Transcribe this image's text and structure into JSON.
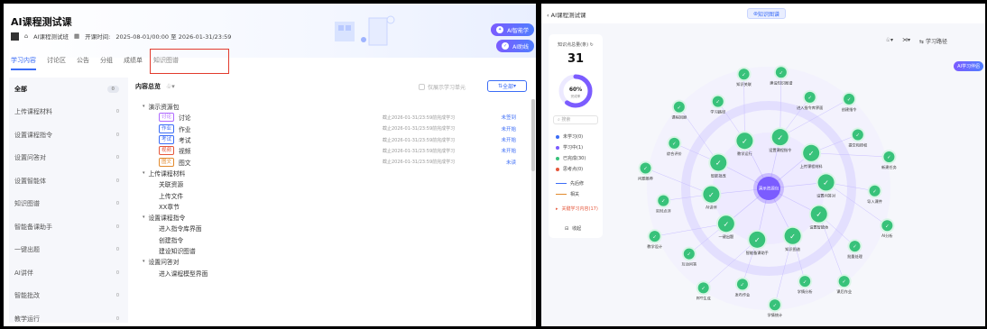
{
  "left": {
    "course_title": "AI课程测试课",
    "class_name": "AI课程测试班",
    "period_label": "开课时间:",
    "period_value": "2025-08-01/00:00 至 2026-01-31/23:59",
    "pill_top": "AI智能学",
    "pill_bottom": "AI助线",
    "tabs": [
      "学习内容",
      "讨论区",
      "公告",
      "分组",
      "成绩单",
      "知识图谱"
    ],
    "sidebar": [
      {
        "label": "全部",
        "count": "0"
      },
      {
        "label": "上传课程材料",
        "count": "0"
      },
      {
        "label": "设置课程指令",
        "count": "0"
      },
      {
        "label": "设置问答对",
        "count": "0"
      },
      {
        "label": "设置智能体",
        "count": "0"
      },
      {
        "label": "知识图谱",
        "count": "0"
      },
      {
        "label": "智能备课助手",
        "count": "0"
      },
      {
        "label": "一键出题",
        "count": "0"
      },
      {
        "label": "AI讲伴",
        "count": "0"
      },
      {
        "label": "智能批改",
        "count": "0"
      },
      {
        "label": "教学运行",
        "count": "0"
      }
    ],
    "overview_title": "内容总览",
    "only_show": "仅展示学习单元",
    "filter_label": "全部",
    "tree": [
      {
        "level": 0,
        "caret": "▾",
        "label": "演示资源包"
      },
      {
        "level": 1,
        "tag": "讨论",
        "tag_color": "#b06bff",
        "label": "讨论",
        "time": "截止2026-01-31/23:59前完成学习",
        "status": "未签到"
      },
      {
        "level": 1,
        "tag": "作业",
        "tag_color": "#3b6cf6",
        "label": "作业",
        "time": "截止2026-01-31/23:59前完成学习",
        "status": "未开始"
      },
      {
        "level": 1,
        "tag": "考试",
        "tag_color": "#3b6cf6",
        "label": "考试",
        "time": "截止2026-01-31/23:59前完成学习",
        "status": "未开始"
      },
      {
        "level": 1,
        "tag": "视频",
        "tag_color": "#e5573b",
        "label": "视频",
        "time": "截止2026-01-31/23:59前完成学习",
        "status": "未开始"
      },
      {
        "level": 1,
        "tag": "图文",
        "tag_color": "#e28a2d",
        "label": "图文",
        "time": "截止2026-01-31/23:59前完成学习",
        "status": "未读"
      },
      {
        "level": 0,
        "caret": "▾",
        "label": "上传课程材料"
      },
      {
        "level": 1,
        "label": "关联资源"
      },
      {
        "level": 1,
        "label": "上传文件"
      },
      {
        "level": 1,
        "label": "XX章节"
      },
      {
        "level": 0,
        "caret": "▾",
        "label": "设置课程指令"
      },
      {
        "level": 1,
        "label": "进入指令库界面"
      },
      {
        "level": 1,
        "label": "创建指令"
      },
      {
        "level": 1,
        "label": "建设知识图谱"
      },
      {
        "level": 0,
        "caret": "▾",
        "label": "设置问答对"
      },
      {
        "level": 1,
        "label": "进入课程模型界面"
      }
    ]
  },
  "right": {
    "back_label": "AI课程测试课",
    "graph_tab": "知识图谱",
    "stat_label": "知识点总量(条)",
    "stat_value": "31",
    "progress_value": "60%",
    "progress_fraction": 0.6,
    "progress_caption": "完成率",
    "search_placeholder": "搜索",
    "legend": [
      {
        "label": "未学习(0)",
        "color": "#3b6cf6"
      },
      {
        "label": "学习中(1)",
        "color": "#7b5cff"
      },
      {
        "label": "已完成(30)",
        "color": "#38c27a"
      },
      {
        "label": "思考点(0)",
        "color": "#e5573b"
      }
    ],
    "rel_legend": [
      {
        "label": "先后修",
        "color": "#3b6cf6"
      },
      {
        "label": "相关",
        "color": "#e28a2d"
      }
    ],
    "focus_label": "关键学习内容(17)",
    "collapse_label": "收起",
    "tool_labels": [
      "♧▾",
      "⋊▾",
      "学习路径"
    ],
    "ai_pill": "AI学习伴侣",
    "center_label": "演示资源包",
    "inner_nodes": [
      "设置课程指令",
      "上传课程材料",
      "设置问答对",
      "设置智能体",
      "知识图谱",
      "智能备课助手",
      "一键出题",
      "AI讲伴",
      "智能批改",
      "教学运行"
    ],
    "outer_nodes": [
      "建设知识图谱",
      "进入指令库界面",
      "创建指令",
      "提交和授权",
      "新建任务",
      "导入课件",
      "AI分析",
      "批量处理",
      "课后作业",
      "学情分析",
      "学情统计",
      "发布作业",
      "PPT生成",
      "互动问答",
      "教学设计",
      "实时点评",
      "问题推荐",
      "综合评价",
      "课程回顾",
      "学习路径",
      "知识关联"
    ]
  }
}
